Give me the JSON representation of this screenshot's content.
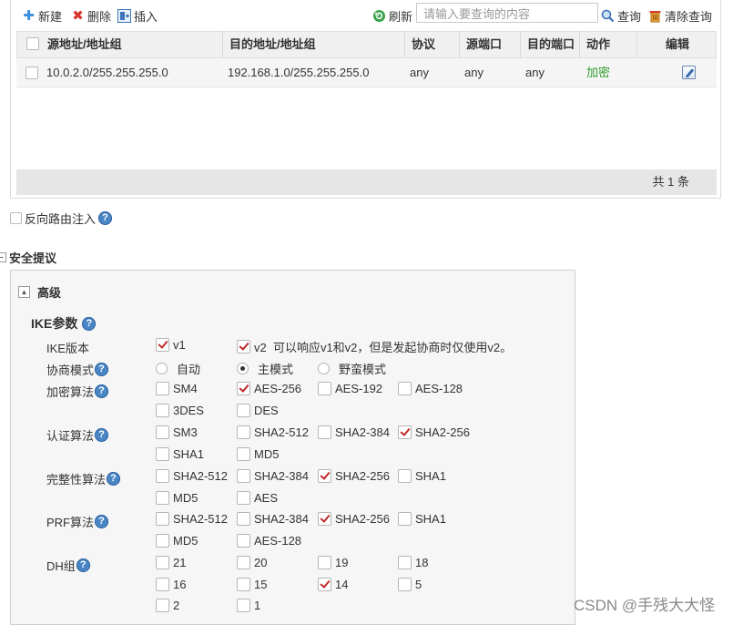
{
  "toolbar": {
    "new_label": "新建",
    "delete_label": "删除",
    "insert_label": "插入",
    "refresh_label": "刷新",
    "search_placeholder": "请输入要查询的内容",
    "query_label": "查询",
    "clear_query_label": "清除查询"
  },
  "table": {
    "columns": [
      "源地址/地址组",
      "目的地址/地址组",
      "协议",
      "源端口",
      "目的端口",
      "动作",
      "编辑"
    ],
    "rows": [
      {
        "src": "10.0.2.0/255.255.255.0",
        "dst": "192.168.1.0/255.255.255.0",
        "protocol": "any",
        "src_port": "any",
        "dst_port": "any",
        "action": "加密"
      }
    ],
    "footer": "共 1 条"
  },
  "reverse_route": {
    "label": "反向路由注入",
    "checked": false
  },
  "security_proposal": {
    "title": "安全提议"
  },
  "advanced": {
    "title": "高级",
    "ike_title": "IKE参数",
    "ike_version": {
      "label": "IKE版本",
      "options": [
        {
          "label": "v1",
          "checked": true
        },
        {
          "label": "v2  可以响应v1和v2，但是发起协商时仅使用v2。",
          "checked": true
        }
      ]
    },
    "negotiation_mode": {
      "label": "协商模式",
      "options": [
        "自动",
        "主模式",
        "野蛮模式"
      ],
      "selected": "主模式"
    },
    "encryption": {
      "label": "加密算法",
      "options": [
        {
          "label": "SM4",
          "checked": false
        },
        {
          "label": "AES-256",
          "checked": true
        },
        {
          "label": "AES-192",
          "checked": false
        },
        {
          "label": "AES-128",
          "checked": false
        },
        {
          "label": "3DES",
          "checked": false
        },
        {
          "label": "DES",
          "checked": false
        }
      ]
    },
    "authentication": {
      "label": "认证算法",
      "options": [
        {
          "label": "SM3",
          "checked": false
        },
        {
          "label": "SHA2-512",
          "checked": false
        },
        {
          "label": "SHA2-384",
          "checked": false
        },
        {
          "label": "SHA2-256",
          "checked": true
        },
        {
          "label": "SHA1",
          "checked": false
        },
        {
          "label": "MD5",
          "checked": false
        }
      ]
    },
    "integrity": {
      "label": "完整性算法",
      "options": [
        {
          "label": "SHA2-512",
          "checked": false
        },
        {
          "label": "SHA2-384",
          "checked": false
        },
        {
          "label": "SHA2-256",
          "checked": true
        },
        {
          "label": "SHA1",
          "checked": false
        },
        {
          "label": "MD5",
          "checked": false
        },
        {
          "label": "AES",
          "checked": false
        }
      ]
    },
    "prf": {
      "label": "PRF算法",
      "options": [
        {
          "label": "SHA2-512",
          "checked": false
        },
        {
          "label": "SHA2-384",
          "checked": false
        },
        {
          "label": "SHA2-256",
          "checked": true
        },
        {
          "label": "SHA1",
          "checked": false
        },
        {
          "label": "MD5",
          "checked": false
        },
        {
          "label": "AES-128",
          "checked": false
        }
      ]
    },
    "dh_group": {
      "label": "DH组",
      "options": [
        {
          "label": "21",
          "checked": false
        },
        {
          "label": "20",
          "checked": false
        },
        {
          "label": "19",
          "checked": false
        },
        {
          "label": "18",
          "checked": false
        },
        {
          "label": "16",
          "checked": false
        },
        {
          "label": "15",
          "checked": false
        },
        {
          "label": "14",
          "checked": true
        },
        {
          "label": "5",
          "checked": false
        },
        {
          "label": "2",
          "checked": false
        },
        {
          "label": "1",
          "checked": false
        }
      ]
    }
  },
  "watermark": "CSDN @手残大大怪",
  "colors": {
    "check_mark": "#c0282a",
    "action_green": "#2e9e2e",
    "help_blue": "#4a86c5",
    "new_icon_blue": "#3b8de0",
    "delete_icon_red": "#d9342b",
    "refresh_icon_green": "#3aa04a",
    "header_bg": "#f0f0f0",
    "footer_bg": "#e6e6e6",
    "advanced_bg": "#f6f6f6"
  }
}
